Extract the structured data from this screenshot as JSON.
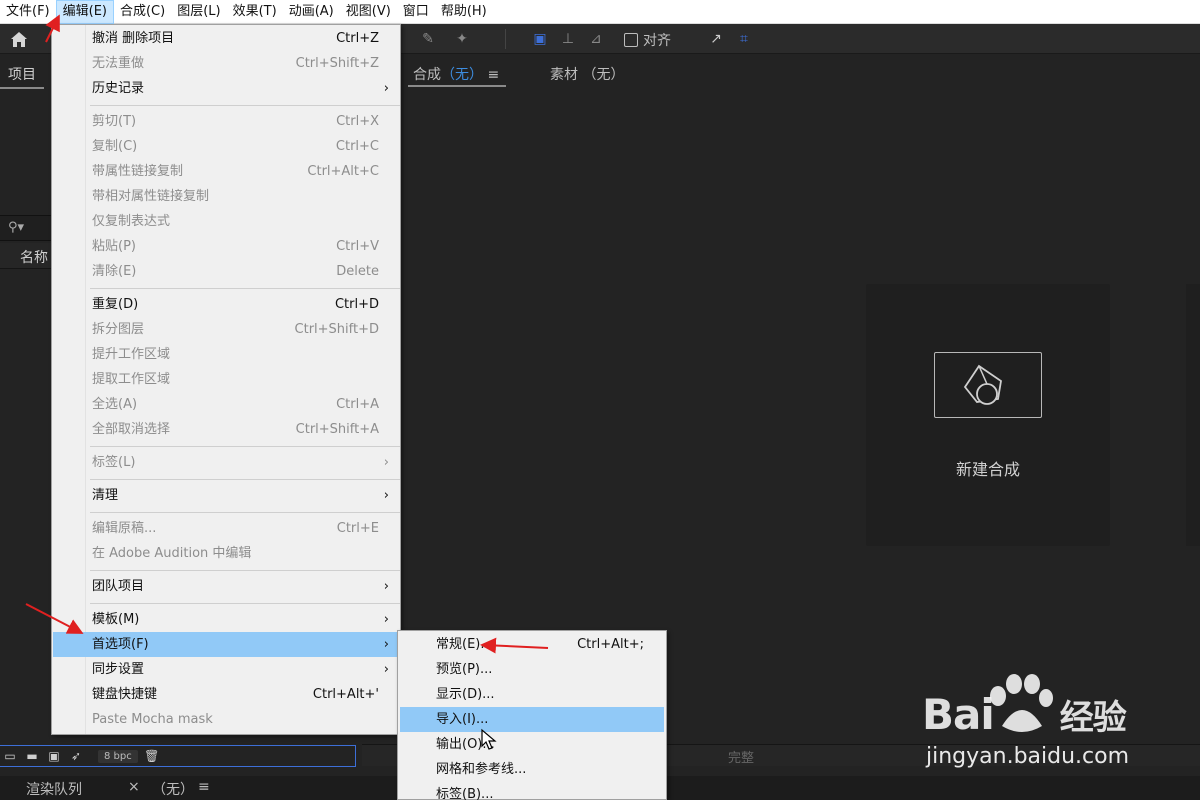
{
  "menubar": {
    "items": [
      "文件(F)",
      "编辑(E)",
      "合成(C)",
      "图层(L)",
      "效果(T)",
      "动画(A)",
      "视图(V)",
      "窗口",
      "帮助(H)"
    ],
    "active_index": 1
  },
  "toolbar": {
    "align_label": "对齐"
  },
  "project_panel": {
    "tab_label": "项目",
    "name_column": "名称",
    "bpc": "8 bpc"
  },
  "comp_panel": {
    "comp_tab_label": "合成",
    "comp_tab_value": "（无）",
    "footage_tab": "素材 （无）",
    "new_comp_label": "新建合成",
    "footer_quality": "完整"
  },
  "render_bar": {
    "label": "渲染队列",
    "tab_value": "（无）"
  },
  "edit_menu": {
    "items": [
      {
        "label": "撤消 删除项目",
        "shortcut": "Ctrl+Z",
        "enabled": true
      },
      {
        "label": "无法重做",
        "shortcut": "Ctrl+Shift+Z",
        "enabled": false
      },
      {
        "label": "历史记录",
        "shortcut": "",
        "enabled": true,
        "submenu": true
      },
      {
        "label": "剪切(T)",
        "shortcut": "Ctrl+X",
        "enabled": false
      },
      {
        "label": "复制(C)",
        "shortcut": "Ctrl+C",
        "enabled": false
      },
      {
        "label": "带属性链接复制",
        "shortcut": "Ctrl+Alt+C",
        "enabled": false
      },
      {
        "label": "带相对属性链接复制",
        "shortcut": "",
        "enabled": false
      },
      {
        "label": "仅复制表达式",
        "shortcut": "",
        "enabled": false
      },
      {
        "label": "粘贴(P)",
        "shortcut": "Ctrl+V",
        "enabled": false
      },
      {
        "label": "清除(E)",
        "shortcut": "Delete",
        "enabled": false
      },
      {
        "label": "重复(D)",
        "shortcut": "Ctrl+D",
        "enabled": true
      },
      {
        "label": "拆分图层",
        "shortcut": "Ctrl+Shift+D",
        "enabled": false
      },
      {
        "label": "提升工作区域",
        "shortcut": "",
        "enabled": false
      },
      {
        "label": "提取工作区域",
        "shortcut": "",
        "enabled": false
      },
      {
        "label": "全选(A)",
        "shortcut": "Ctrl+A",
        "enabled": false
      },
      {
        "label": "全部取消选择",
        "shortcut": "Ctrl+Shift+A",
        "enabled": false
      },
      {
        "label": "标签(L)",
        "shortcut": "",
        "enabled": false,
        "submenu": true
      },
      {
        "label": "清理",
        "shortcut": "",
        "enabled": true,
        "submenu": true
      },
      {
        "label": "编辑原稿...",
        "shortcut": "Ctrl+E",
        "enabled": false
      },
      {
        "label": "在 Adobe Audition 中编辑",
        "shortcut": "",
        "enabled": false
      },
      {
        "label": "团队项目",
        "shortcut": "",
        "enabled": true,
        "submenu": true
      },
      {
        "label": "模板(M)",
        "shortcut": "",
        "enabled": true,
        "submenu": true
      },
      {
        "label": "首选项(F)",
        "shortcut": "",
        "enabled": true,
        "submenu": true,
        "highlighted": true
      },
      {
        "label": "同步设置",
        "shortcut": "",
        "enabled": true,
        "submenu": true
      },
      {
        "label": "键盘快捷键",
        "shortcut": "Ctrl+Alt+'",
        "enabled": true
      },
      {
        "label": "Paste Mocha mask",
        "shortcut": "",
        "enabled": false
      }
    ]
  },
  "preferences_submenu": {
    "items": [
      {
        "label": "常规(E)...",
        "shortcut": "Ctrl+Alt+;"
      },
      {
        "label": "预览(P)...",
        "shortcut": ""
      },
      {
        "label": "显示(D)...",
        "shortcut": ""
      },
      {
        "label": "导入(I)...",
        "shortcut": "",
        "highlighted": true
      },
      {
        "label": "输出(O)...",
        "shortcut": ""
      },
      {
        "label": "网格和参考线...",
        "shortcut": ""
      },
      {
        "label": "标签(B)...",
        "shortcut": ""
      }
    ]
  },
  "watermark": {
    "brand": "Bai",
    "brand_cn": "经验",
    "url": "jingyan.baidu.com"
  },
  "colors": {
    "menu_bg": "#f0f0f0",
    "menu_highlight": "#91c9f7",
    "panel_bg": "#232323",
    "accent_blue": "#3d6fd8",
    "annotation_red": "#e02020"
  }
}
